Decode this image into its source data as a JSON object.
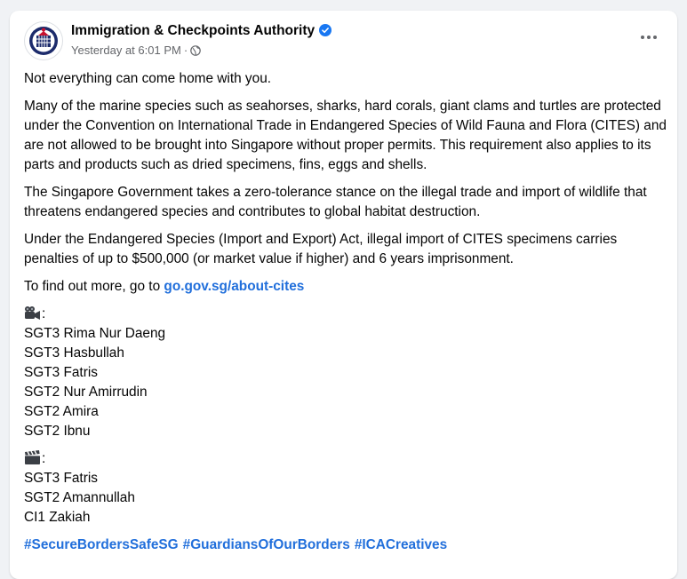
{
  "post": {
    "page_name": "Immigration & Checkpoints Authority",
    "timestamp": "Yesterday at 6:01 PM",
    "dot": "·",
    "paragraphs": [
      "Not everything can come home with you.",
      "Many of the marine species such as seahorses, sharks, hard corals, giant clams and turtles are protected under the Convention on International Trade in Endangered Species of Wild Fauna and Flora (CITES) and are not allowed to be brought into Singapore without proper permits. This requirement also applies to its parts and products such as dried specimens, fins, eggs and shells.",
      "The Singapore Government takes a zero-tolerance stance on the illegal trade and import of wildlife that threatens endangered species and contributes to global habitat destruction.",
      "Under the Endangered Species (Import and Export) Act, illegal import of CITES specimens carries penalties of up to $500,000 (or market value if higher) and 6 years imprisonment."
    ],
    "find_out_prefix": "To find out more, go to ",
    "find_out_link": "go.gov.sg/about-cites",
    "video_credits_icon": "video-camera-icon",
    "video_credits": [
      "SGT3 Rima Nur Daeng",
      "SGT3 Hasbullah",
      "SGT3 Fatris",
      "SGT2 Nur Amirrudin",
      "SGT2 Amira",
      "SGT2 Ibnu"
    ],
    "editing_credits_icon": "clapperboard-icon",
    "editing_credits": [
      "SGT3 Fatris",
      "SGT2 Amannullah",
      "CI1 Zakiah"
    ],
    "colon": ":",
    "hashtags": [
      "#SecureBordersSafeSG",
      "#GuardiansOfOurBorders",
      "#ICACreatives"
    ]
  },
  "colors": {
    "link": "#216fdb",
    "verified": "#1877f2",
    "muted": "#65676b",
    "background": "#f0f2f5"
  }
}
